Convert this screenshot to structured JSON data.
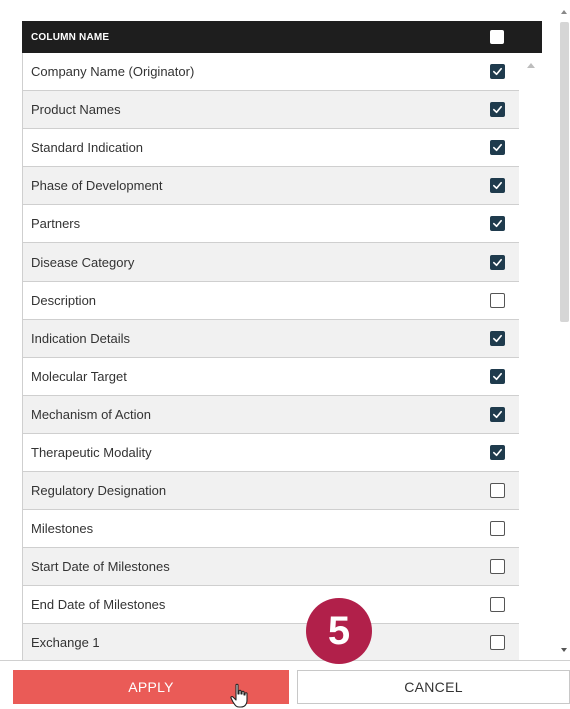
{
  "header": {
    "title": "COLUMN NAME",
    "select_all_checked": false
  },
  "rows": [
    {
      "label": "Company Name (Originator)",
      "checked": true
    },
    {
      "label": "Product Names",
      "checked": true
    },
    {
      "label": "Standard Indication",
      "checked": true
    },
    {
      "label": "Phase of Development",
      "checked": true
    },
    {
      "label": "Partners",
      "checked": true
    },
    {
      "label": "Disease Category",
      "checked": true
    },
    {
      "label": "Description",
      "checked": false
    },
    {
      "label": "Indication Details",
      "checked": true
    },
    {
      "label": "Molecular Target",
      "checked": true
    },
    {
      "label": "Mechanism of Action",
      "checked": true
    },
    {
      "label": "Therapeutic Modality",
      "checked": true
    },
    {
      "label": "Regulatory Designation",
      "checked": false
    },
    {
      "label": "Milestones",
      "checked": false
    },
    {
      "label": "Start Date of Milestones",
      "checked": false
    },
    {
      "label": "End Date of Milestones",
      "checked": false
    },
    {
      "label": "Exchange 1",
      "checked": false
    }
  ],
  "footer": {
    "apply_label": "APPLY",
    "cancel_label": "CANCEL"
  },
  "step_badge": "5",
  "colors": {
    "header_bg": "#1e1e1e",
    "checkbox_checked": "#1f3b4d",
    "apply_bg": "#ea5b57",
    "badge_bg": "#b1204a"
  }
}
